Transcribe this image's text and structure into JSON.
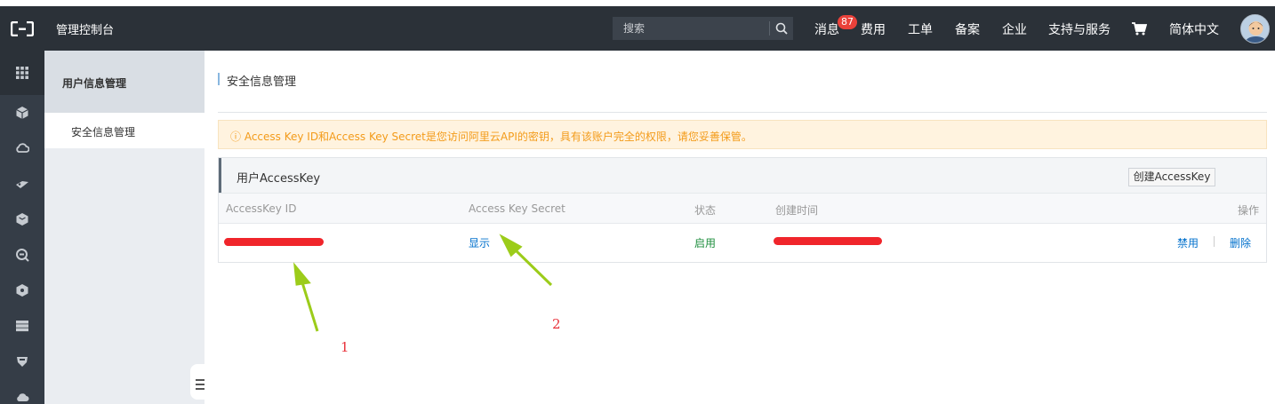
{
  "topbar": {
    "title": "管理控制台",
    "search_placeholder": "搜索",
    "nav": {
      "messages": "消息",
      "messages_badge": "87",
      "billing": "费用",
      "tickets": "工单",
      "icp": "备案",
      "enterprise": "企业",
      "support": "支持与服务",
      "language": "简体中文"
    }
  },
  "submenu": {
    "heading": "用户信息管理",
    "item": "安全信息管理"
  },
  "main": {
    "page_title": "安全信息管理",
    "alert": "ⓘ Access Key ID和Access Key Secret是您访问阿里云API的密钥，具有该账户完全的权限，请您妥善保管。",
    "panel_title": "用户AccessKey",
    "create_button": "创建AccessKey",
    "columns": [
      "AccessKey ID",
      "Access Key Secret",
      "状态",
      "创建时间",
      "操作"
    ],
    "row": {
      "secret_action": "显示",
      "status": "启用",
      "disable": "禁用",
      "delete": "删除"
    }
  },
  "annotations": {
    "label_1": "1",
    "label_2": "2"
  },
  "colors": {
    "topbar_bg": "#2b3138",
    "rail_bg": "#353d47",
    "link": "#0070cc",
    "status_ok": "#1e8e3e",
    "alert_text": "#f39b1a",
    "redaction": "#f0252b",
    "arrow": "#9ccc1a"
  }
}
